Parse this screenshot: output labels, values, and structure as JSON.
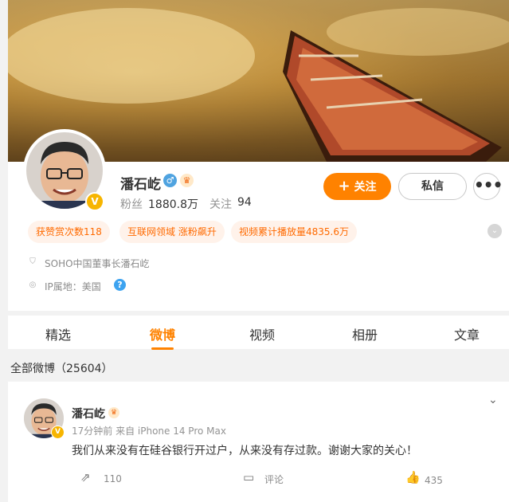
{
  "profile": {
    "name": "潘石屹",
    "fans_label": "粉丝",
    "fans_value": "1880.8万",
    "following_label": "关注",
    "following_value": "94",
    "verified_badge": "V",
    "follow_button": "关注",
    "follow_plus": "+",
    "message_button": "私信",
    "more_button": "•••",
    "gender_icon": "♂",
    "tags": [
      "获赞赏次数118",
      "互联网领域 涨粉飙升",
      "视频累计播放量4835.6万"
    ],
    "description": "SOHO中国董事长潘石屹",
    "ip_location": "IP属地：美国",
    "help_icon": "?",
    "expand_icon": "⌄"
  },
  "tabs": [
    "精选",
    "微博",
    "视频",
    "相册",
    "文章"
  ],
  "active_tab": "微博",
  "feed": {
    "total_label": "全部微博（25604）"
  },
  "post": {
    "author": "潘石屹",
    "meta": "17分钟前  来自 iPhone 14 Pro Max",
    "text": "我们从来没有在硅谷银行开过户，从来没有存过款。谢谢大家的关心！",
    "menu_icon": "⌄",
    "repost_count": "110",
    "comment_label": "评论",
    "like_count": "435"
  },
  "colors": {
    "accent": "#ff8200",
    "tag_bg": "#fff2ea",
    "tag_text": "#ff6a00"
  }
}
